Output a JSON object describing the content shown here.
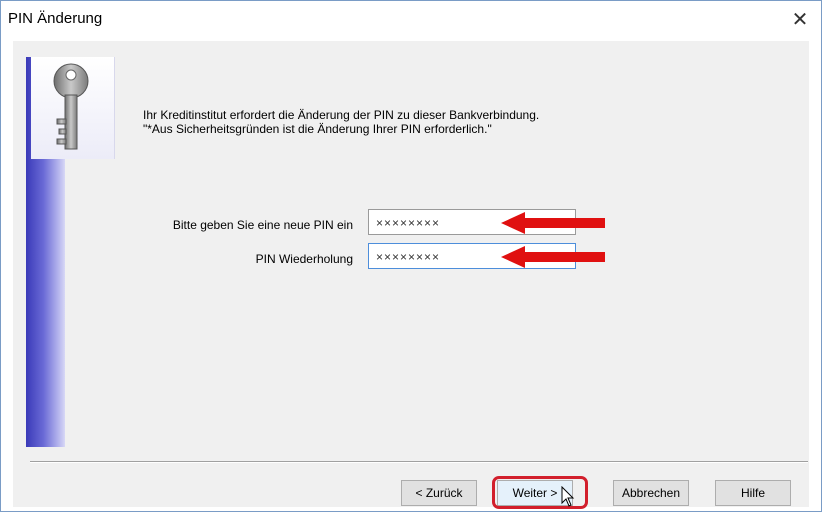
{
  "window": {
    "title": "PIN Änderung",
    "close_glyph": "✕"
  },
  "message": {
    "line1": "Ihr Kreditinstitut erfordert die Änderung der PIN zu dieser Bankverbindung.",
    "line2": "\"*Aus Sicherheitsgründen ist die Änderung Ihrer PIN erforderlich.\""
  },
  "form": {
    "new_pin_label": "Bitte geben Sie eine neue PIN ein",
    "new_pin_value": "××××××××",
    "repeat_pin_label": "PIN Wiederholung",
    "repeat_pin_value": "××××××××"
  },
  "buttons": {
    "back": "< Zurück",
    "next": "Weiter >",
    "cancel": "Abbrechen",
    "help": "Hilfe"
  },
  "icons": [
    "key-icon",
    "close-icon",
    "arrow-icon",
    "mouse-cursor-icon"
  ],
  "colors": {
    "annotation_red": "#e01010",
    "sidebar_blue": "#3a3ab8",
    "focus_border": "#4d8edb"
  }
}
